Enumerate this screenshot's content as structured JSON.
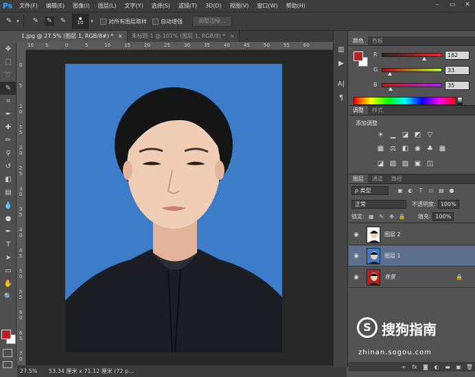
{
  "app": {
    "logo": "Ps"
  },
  "menu": [
    "文件(F)",
    "编辑(E)",
    "图像(I)",
    "图层(L)",
    "文字(Y)",
    "选择(S)",
    "滤镜(T)",
    "3D(D)",
    "视图(V)",
    "窗口(W)",
    "帮助(H)"
  ],
  "window_controls": {
    "minimize": "–",
    "restore": "▭",
    "close": "✕"
  },
  "options": {
    "brush_size": "10",
    "sample_all_layers": "对所有图层取样",
    "auto_enhance": "自动增强",
    "refine_edge": "调整边缘..."
  },
  "tabs": [
    {
      "label": "1.jpg @ 27.5% (图层 1, RGB/8#) *",
      "close": "×"
    },
    {
      "label": "未标题-1 @ 101% (图层 1, RGB/8) *",
      "close": "×"
    }
  ],
  "ruler": {
    "h": [
      "10",
      "5",
      "0",
      "5",
      "10",
      "15",
      "20",
      "25",
      "30",
      "35",
      "40",
      "45",
      "50",
      "55",
      "60"
    ],
    "v": [
      "0",
      "5",
      "1 0",
      "1 5",
      "2 0",
      "2 5",
      "3 0",
      "3 5",
      "4 0",
      "4 5",
      "5 0",
      "5 5",
      "6 0",
      "6 5",
      "7 0"
    ]
  },
  "status": {
    "zoom": "27.5%",
    "doc_info": "53.34 厘米 x 71.12 厘米 (72 p..."
  },
  "color_panel": {
    "tabs": [
      "颜色",
      "色板"
    ],
    "channels": [
      {
        "label": "R",
        "value": "182",
        "level": 0.71
      },
      {
        "label": "G",
        "value": "33",
        "level": 0.13
      },
      {
        "label": "B",
        "value": "35",
        "level": 0.14
      }
    ],
    "fg_color": "#b62121",
    "bg_color": "#ffffff"
  },
  "adjustments_panel": {
    "tabs": [
      "调整",
      "样式"
    ],
    "title": "添加调整"
  },
  "layers_panel": {
    "tabs": [
      "图层",
      "通道",
      "路径"
    ],
    "filter": "ρ 类型",
    "blend_mode": "正常",
    "opacity_label": "不透明度:",
    "opacity": "100%",
    "lock_label": "锁定:",
    "fill_label": "填充:",
    "fill": "100%",
    "layers": [
      {
        "name": "图层 2",
        "selected": false
      },
      {
        "name": "图层 1",
        "selected": true
      },
      {
        "name": "背景",
        "selected": false,
        "locked": true
      }
    ]
  },
  "watermark": {
    "text": "搜狗指南",
    "url": "zhinan.sogou.com"
  },
  "accent_colors": {
    "background_blue": "#3c7cc8",
    "selection_blue": "#5d6f8c",
    "foreground_red": "#b62121"
  }
}
